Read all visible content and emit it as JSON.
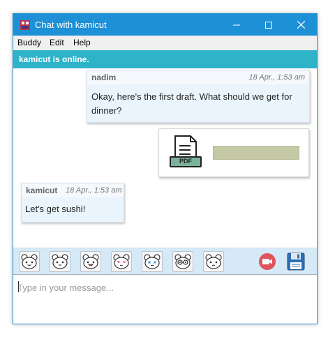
{
  "window": {
    "title": "Chat with kamicut",
    "controls": [
      "minimize-icon",
      "maximize-icon",
      "close-icon"
    ]
  },
  "menu": {
    "items": [
      "Buddy",
      "Edit",
      "Help"
    ]
  },
  "status": {
    "text": "kamicut is online.",
    "color": "#2eb3c9"
  },
  "messages": [
    {
      "sender": "nadim",
      "time": "18 Apr., 1:53 am",
      "lines": [
        "Okay, here's the first draft. What should we get for",
        "dinner?"
      ]
    },
    {
      "type": "attachment",
      "icon": "pdf-file-icon",
      "icon_label": "PDF"
    },
    {
      "sender": "kamicut",
      "time": "18 Apr., 1:53 am",
      "lines": [
        "Let's get sushi!"
      ]
    }
  ],
  "toolbar": {
    "emoticons": [
      "cat-emoticon-smile",
      "cat-emoticon-neutral",
      "cat-emoticon-grin",
      "cat-emoticon-love",
      "cat-emoticon-dizzy",
      "cat-emoticon-glasses",
      "cat-emoticon-pout"
    ],
    "video_icon": "video-call-icon",
    "save_icon": "save-floppy-icon"
  },
  "input": {
    "placeholder": "Type in your message...",
    "value": ""
  },
  "colors": {
    "titlebar": "#1e90d6",
    "accent": "#2eb3c9",
    "bubble": "#eaf4fc",
    "toolbar": "#d6e9f7"
  }
}
